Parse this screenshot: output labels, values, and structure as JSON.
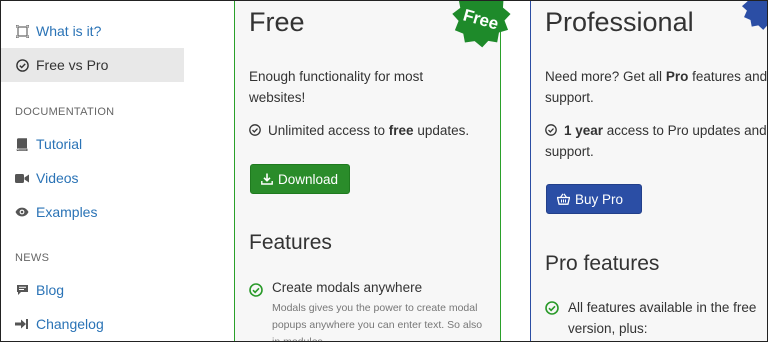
{
  "sidebar": {
    "items_top": [
      {
        "label": "What is it?",
        "icon": "expand-square-icon"
      },
      {
        "label": "Free vs Pro",
        "icon": "check-circle-icon"
      }
    ],
    "doc_heading": "DOCUMENTATION",
    "doc_items": [
      {
        "label": "Tutorial",
        "icon": "book-icon"
      },
      {
        "label": "Videos",
        "icon": "video-camera-icon"
      },
      {
        "label": "Examples",
        "icon": "eye-icon"
      }
    ],
    "news_heading": "NEWS",
    "news_items": [
      {
        "label": "Blog",
        "icon": "comment-icon"
      },
      {
        "label": "Changelog",
        "icon": "sign-in-arrow-icon"
      }
    ]
  },
  "free": {
    "badge": "Free",
    "title": "Free",
    "intro": "Enough functionality for most websites!",
    "access_pre": "Unlimited access to ",
    "access_bold": "free",
    "access_post": " updates.",
    "download_label": "Download",
    "features_title": "Features",
    "feature1_title": "Create modals anywhere",
    "feature1_desc": "Modals gives you the power to create modal popups anywhere you can enter text. So also in modules."
  },
  "pro": {
    "title": "Professional",
    "intro_pre": "Need more? Get all ",
    "intro_bold": "Pro",
    "intro_post": " features and support.",
    "access_bold": "1 year",
    "access_post": " access to Pro updates and support.",
    "buy_label": "Buy Pro",
    "features_title": "Pro features",
    "feature1_title": "All features available in the free version, plus:"
  },
  "colors": {
    "link": "#2a73b6",
    "free_green": "#2a8c2a",
    "pro_blue": "#2b4ea5"
  }
}
